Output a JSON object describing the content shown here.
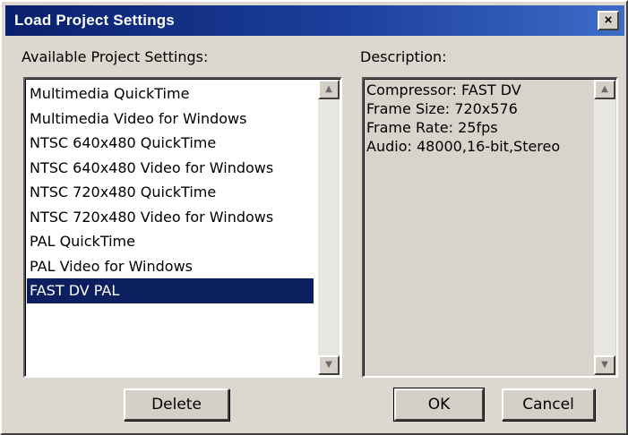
{
  "window": {
    "title": "Load Project Settings",
    "close_glyph": "×"
  },
  "left_panel": {
    "label": "Available Project Settings:",
    "items": [
      {
        "label": "Multimedia QuickTime",
        "selected": false
      },
      {
        "label": "Multimedia Video for Windows",
        "selected": false
      },
      {
        "label": "NTSC 640x480 QuickTime",
        "selected": false
      },
      {
        "label": "NTSC 640x480 Video for Windows",
        "selected": false
      },
      {
        "label": "NTSC 720x480 QuickTime",
        "selected": false
      },
      {
        "label": "NTSC 720x480 Video for Windows",
        "selected": false
      },
      {
        "label": "PAL QuickTime",
        "selected": false
      },
      {
        "label": "PAL Video for Windows",
        "selected": false
      },
      {
        "label": "FAST DV PAL",
        "selected": true
      }
    ],
    "scroll_up_glyph": "▲",
    "scroll_down_glyph": "▼"
  },
  "right_panel": {
    "label": "Description:",
    "lines": [
      "Compressor: FAST DV",
      "Frame Size: 720x576",
      "Frame Rate: 25fps",
      "Audio: 48000,16-bit,Stereo"
    ],
    "scroll_up_glyph": "▲",
    "scroll_down_glyph": "▼"
  },
  "buttons": {
    "delete": "Delete",
    "ok": "OK",
    "cancel": "Cancel"
  },
  "colors": {
    "title_bar": "#0a1f6c",
    "selection": "#0c1f5e",
    "dialog_face": "#d4d0c8"
  }
}
